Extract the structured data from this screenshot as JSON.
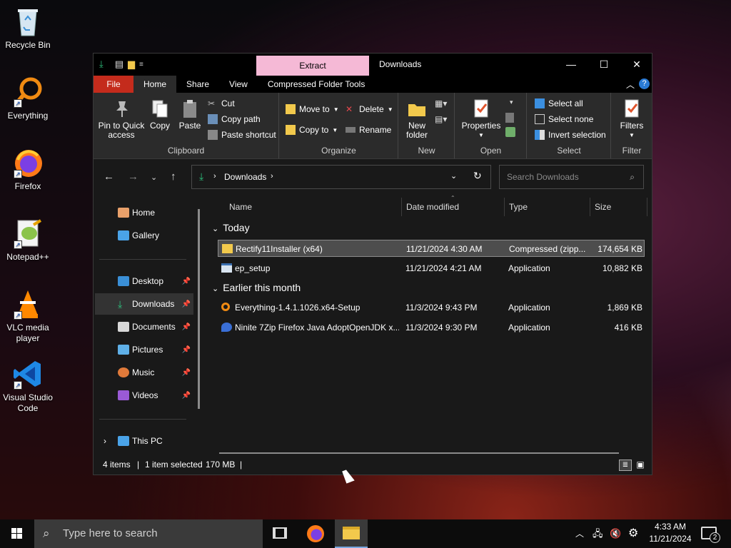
{
  "desktop": {
    "icons": [
      {
        "name": "recycle-bin",
        "label": "Recycle Bin"
      },
      {
        "name": "everything",
        "label": "Everything"
      },
      {
        "name": "firefox",
        "label": "Firefox"
      },
      {
        "name": "notepadpp",
        "label": "Notepad++"
      },
      {
        "name": "vlc",
        "label": "VLC media player"
      },
      {
        "name": "vscode",
        "label": "Visual Studio Code"
      }
    ]
  },
  "window": {
    "title": "Downloads",
    "context_tab": "Extract",
    "tabs": {
      "file": "File",
      "home": "Home",
      "share": "Share",
      "view": "View",
      "tools": "Compressed Folder Tools"
    },
    "ribbon": {
      "clipboard": {
        "label": "Clipboard",
        "pin": "Pin to Quick access",
        "copy": "Copy",
        "paste": "Paste",
        "cut": "Cut",
        "copy_path": "Copy path",
        "paste_shortcut": "Paste shortcut"
      },
      "organize": {
        "label": "Organize",
        "move_to": "Move to",
        "copy_to": "Copy to",
        "delete": "Delete",
        "rename": "Rename"
      },
      "new": {
        "label": "New",
        "new_folder": "New folder"
      },
      "open": {
        "label": "Open",
        "properties": "Properties"
      },
      "select": {
        "label": "Select",
        "select_all": "Select all",
        "select_none": "Select none",
        "invert": "Invert selection"
      },
      "filter": {
        "label": "Filter",
        "filters": "Filters"
      }
    },
    "address": {
      "path": "Downloads",
      "search_placeholder": "Search Downloads"
    },
    "nav": {
      "home": "Home",
      "gallery": "Gallery",
      "desktop": "Desktop",
      "downloads": "Downloads",
      "documents": "Documents",
      "pictures": "Pictures",
      "music": "Music",
      "videos": "Videos",
      "this_pc": "This PC"
    },
    "columns": {
      "name": "Name",
      "date": "Date modified",
      "type": "Type",
      "size": "Size"
    },
    "groups": {
      "today": "Today",
      "earlier": "Earlier this month"
    },
    "files": [
      {
        "name": "Rectify11Installer (x64)",
        "date": "11/21/2024 4:30 AM",
        "type": "Compressed (zipp...",
        "size": "174,654 KB"
      },
      {
        "name": "ep_setup",
        "date": "11/21/2024 4:21 AM",
        "type": "Application",
        "size": "10,882 KB"
      },
      {
        "name": "Everything-1.4.1.1026.x64-Setup",
        "date": "11/3/2024 9:43 PM",
        "type": "Application",
        "size": "1,869 KB"
      },
      {
        "name": "Ninite 7Zip Firefox Java AdoptOpenJDK x...",
        "date": "11/3/2024 9:30 PM",
        "type": "Application",
        "size": "416 KB"
      }
    ],
    "status": {
      "count": "4 items",
      "selected": "1 item selected",
      "size": "170 MB"
    }
  },
  "taskbar": {
    "search_placeholder": "Type here to search",
    "time": "4:33 AM",
    "date": "11/21/2024",
    "notif_count": "2"
  }
}
